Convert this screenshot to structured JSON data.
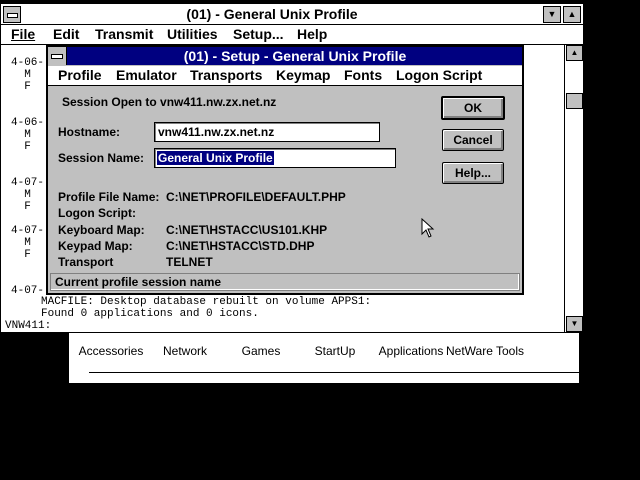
{
  "program_group": {
    "items": [
      "Accessories",
      "Network",
      "Games",
      "StartUp",
      "Applications",
      "NetWare Tools"
    ]
  },
  "terminal": {
    "title": "(01) - General Unix Profile",
    "menu": [
      "File",
      "Edit",
      "Transmit",
      "Utilities",
      "Setup...",
      "Help"
    ],
    "lines": [
      {
        "text": "4-06-"
      },
      {
        "text": "  M"
      },
      {
        "text": "  F"
      },
      {
        "text": ""
      },
      {
        "text": ""
      },
      {
        "text": "4-06-"
      },
      {
        "text": "  M"
      },
      {
        "text": "  F"
      },
      {
        "text": ""
      },
      {
        "text": ""
      },
      {
        "text": "4-07-"
      },
      {
        "text": "  M"
      },
      {
        "text": "  F"
      },
      {
        "text": ""
      },
      {
        "text": ""
      },
      {
        "text": "4-07-"
      },
      {
        "text": "  M"
      },
      {
        "text": "  F"
      },
      {
        "text": ""
      },
      {
        "text": ""
      },
      {
        "text": "4-07-"
      },
      {
        "text": "MACFILE: Desktop database rebuilt on volume APPS1:"
      },
      {
        "text": "Found 0 applications and 0 icons."
      },
      {
        "text": "VNW411:"
      }
    ]
  },
  "dialog": {
    "title": "(01) - Setup - General Unix Profile",
    "menu": [
      "Profile",
      "Emulator",
      "Transports",
      "Keymap",
      "Fonts",
      "Logon Script"
    ],
    "session_open": "Session Open to vnw411.nw.zx.net.nz",
    "hostname_label": "Hostname:",
    "hostname_value": "vnw411.nw.zx.net.nz",
    "session_name_label": "Session Name:",
    "session_name_value": "General Unix Profile",
    "info": [
      {
        "label": "Profile File Name:",
        "value": "C:\\NET\\PROFILE\\DEFAULT.PHP"
      },
      {
        "label": "Logon Script:",
        "value": ""
      },
      {
        "label": "Keyboard Map:",
        "value": "C:\\NET\\HSTACC\\US101.KHP"
      },
      {
        "label": "Keypad Map:",
        "value": "C:\\NET\\HSTACC\\STD.DHP"
      },
      {
        "label": "Transport",
        "value": "TELNET"
      }
    ],
    "buttons": {
      "ok": "OK",
      "cancel": "Cancel",
      "help": "Help..."
    },
    "status": "Current profile session name"
  }
}
